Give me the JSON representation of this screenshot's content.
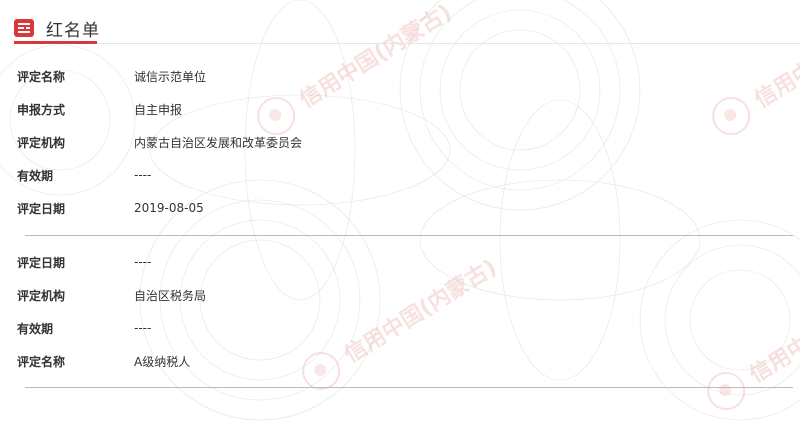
{
  "section": {
    "title": "红名单",
    "icon": "list-icon",
    "accent_color": "#d9383a"
  },
  "watermark": {
    "text": "信用中国(内蒙古)"
  },
  "records": [
    {
      "fields": [
        {
          "label": "评定名称",
          "value": "诚信示范单位"
        },
        {
          "label": "申报方式",
          "value": "自主申报"
        },
        {
          "label": "评定机构",
          "value": "内蒙古自治区发展和改革委员会"
        },
        {
          "label": "有效期",
          "value": "----"
        },
        {
          "label": "评定日期",
          "value": "2019-08-05"
        }
      ]
    },
    {
      "fields": [
        {
          "label": "评定日期",
          "value": "----"
        },
        {
          "label": "评定机构",
          "value": "自治区税务局"
        },
        {
          "label": "有效期",
          "value": "----"
        },
        {
          "label": "评定名称",
          "value": "A级纳税人"
        }
      ]
    }
  ]
}
